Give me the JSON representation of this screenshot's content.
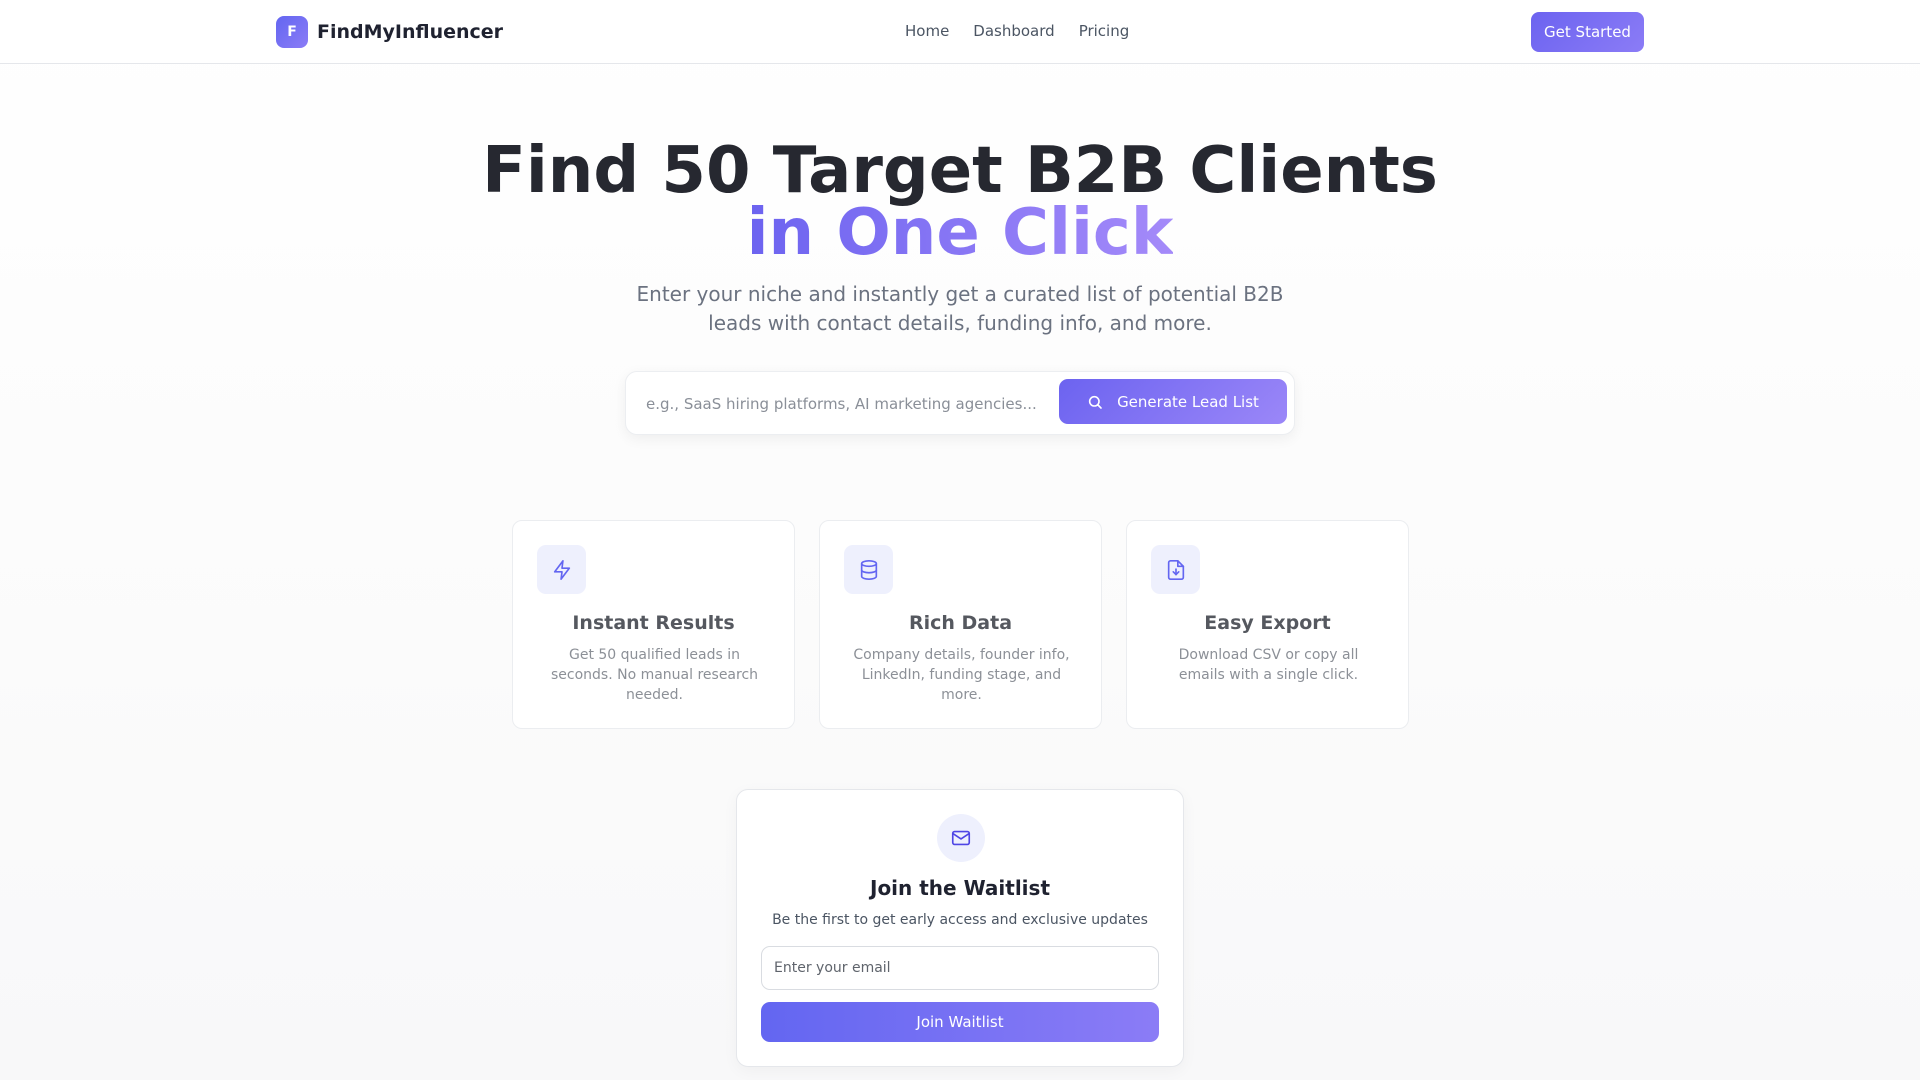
{
  "header": {
    "logo_letter": "F",
    "brand": "FindMyInfluencer",
    "nav": [
      {
        "label": "Home"
      },
      {
        "label": "Dashboard"
      },
      {
        "label": "Pricing"
      }
    ],
    "cta_label": "Get Started"
  },
  "hero": {
    "title_line1": "Find 50 Target B2B Clients",
    "title_line2": "in One Click",
    "subtitle": "Enter your niche and instantly get a curated list of potential B2B leads with contact details, funding info, and more."
  },
  "search": {
    "placeholder": "e.g., SaaS hiring platforms, AI marketing agencies...",
    "value": "",
    "button_label": "Generate Lead List",
    "button_icon": "search-icon"
  },
  "features": [
    {
      "icon": "lightning-icon",
      "title": "Instant Results",
      "description": "Get 50 qualified leads in seconds. No manual research needed."
    },
    {
      "icon": "database-icon",
      "title": "Rich Data",
      "description": "Company details, founder info, LinkedIn, funding stage, and more."
    },
    {
      "icon": "file-download-icon",
      "title": "Easy Export",
      "description": "Download CSV or copy all emails with a single click."
    }
  ],
  "waitlist": {
    "icon": "mail-icon",
    "title": "Join the Waitlist",
    "subtitle": "Be the first to get early access and exclusive updates",
    "email_placeholder": "Enter your email",
    "email_value": "",
    "button_label": "Join Waitlist"
  },
  "colors": {
    "accent": "#6c63f0",
    "accent_light": "#9b87f8",
    "icon_bg": "#eef0fd",
    "icon_stroke": "#6366f1"
  }
}
